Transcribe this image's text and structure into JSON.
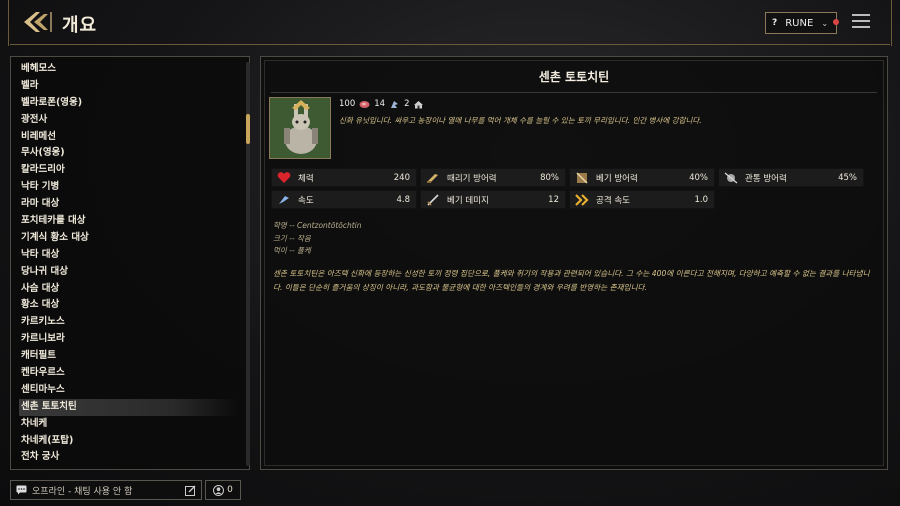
{
  "header": {
    "title": "개요",
    "help_label": "?",
    "account_label": "RUNE"
  },
  "sidebar": {
    "items": [
      {
        "label": "베헤모스"
      },
      {
        "label": "벨라"
      },
      {
        "label": "벨라로폰(영웅)"
      },
      {
        "label": "광전사"
      },
      {
        "label": "비레메선"
      },
      {
        "label": "무사(영웅)"
      },
      {
        "label": "칼라드리아"
      },
      {
        "label": "낙타 기병"
      },
      {
        "label": "라마 대상"
      },
      {
        "label": "포치테카를 대상"
      },
      {
        "label": "기계식 황소 대상"
      },
      {
        "label": "낙타 대상"
      },
      {
        "label": "당나귀 대상"
      },
      {
        "label": "사슴 대상"
      },
      {
        "label": "황소 대상"
      },
      {
        "label": "카르키노스"
      },
      {
        "label": "카르니보라"
      },
      {
        "label": "캐터필트"
      },
      {
        "label": "켄타우르스"
      },
      {
        "label": "센티마누스"
      },
      {
        "label": "센촌 토토치틴"
      },
      {
        "label": "차네케"
      },
      {
        "label": "차네케(포탑)"
      },
      {
        "label": "전차 궁사"
      }
    ],
    "selected_index": 20
  },
  "detail": {
    "name": "센촌 토토치틴",
    "hp_cost": "100",
    "meat_cost": "14",
    "pop_cost": "2",
    "description": "신화 유닛입니다. 싸우고 농장이나 열매 나무를 먹어 개체 수를 늘릴 수 있는 토끼 무리입니다. 인간 병사에 강합니다.",
    "stats": [
      {
        "icon": "heart-icon",
        "name": "체력",
        "value": "240"
      },
      {
        "icon": "hack-armor-icon",
        "name": "때리기 방어력",
        "value": "80%"
      },
      {
        "icon": "slash-armor-icon",
        "name": "베기 방어력",
        "value": "40%"
      },
      {
        "icon": "pierce-armor-icon",
        "name": "관통 방어력",
        "value": "45%"
      },
      {
        "icon": "speed-icon",
        "name": "속도",
        "value": "4.8"
      },
      {
        "icon": "sword-icon",
        "name": "베기 데미지",
        "value": "12"
      },
      {
        "icon": "attack-speed-icon",
        "name": "공격 속도",
        "value": "1.0"
      }
    ],
    "attributes": [
      "학명 -- Centzontōtōchtin",
      "크기 -- 작음",
      "먹이 -- 풀케"
    ],
    "lore": "센촌 토토치틴은 아즈텍 신화에 등장하는 신성한 토끼 정령 집단으로, 풀케와 취기의 작용과 관련되어 있습니다. 그 수는 400에 이른다고 전해지며, 다양하고 예측할 수 없는 결과를 나타냅니다. 이들은 단순히 즐거움의 상징이 아니라, 과도함과 불균형에 대한 아즈텍인들의 경계와 우려를 반영하는 존재입니다."
  },
  "chat": {
    "status_text": "오프라인 - 채팅 사용 안 함",
    "friends_count": "0"
  },
  "colors": {
    "accent_gold": "#c8a55a",
    "lore_text": "#d8c48a"
  }
}
